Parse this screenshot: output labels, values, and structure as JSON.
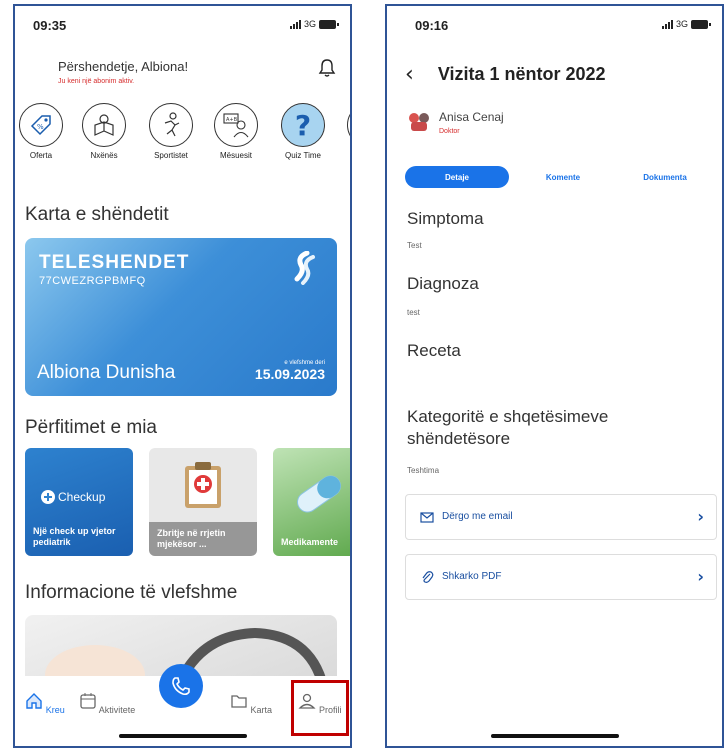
{
  "left_screen": {
    "status": {
      "time": "09:35",
      "network": "3G"
    },
    "greeting": "Përshendetje, Albiona!",
    "subscription_note": "Ju keni një abonim aktiv.",
    "categories": [
      {
        "label": "Oferta",
        "icon": "discount-tag-icon"
      },
      {
        "label": "Nxënës",
        "icon": "student-reading-icon"
      },
      {
        "label": "Sportistet",
        "icon": "athlete-icon"
      },
      {
        "label": "Mësuesit",
        "icon": "teacher-icon"
      },
      {
        "label": "Quiz Time",
        "icon": "question-mark-icon"
      }
    ],
    "health_card_title": "Karta e shëndetit",
    "card": {
      "brand": "TELESHENDET",
      "code": "77CWEZRGPBMFQ",
      "holder": "Albiona Dunisha",
      "valid_label": "e vlefshme deri",
      "valid_date": "15.09.2023"
    },
    "benefits_title": "Përfitimet e mia",
    "benefits": [
      {
        "title": "Një check up vjetor pediatrik",
        "badge": "Checkup"
      },
      {
        "title": "Zbritje në rrjetin mjekësor ..."
      },
      {
        "title": "Medikamente"
      }
    ],
    "info_title": "Informacione të vlefshme",
    "tabs": [
      {
        "label": "Kreu",
        "icon": "home-icon",
        "active": true
      },
      {
        "label": "Aktivitete",
        "icon": "calendar-icon"
      },
      {
        "label": "Karta",
        "icon": "folder-icon"
      },
      {
        "label": "Profili",
        "icon": "user-icon"
      }
    ],
    "accent": "#1a73e8",
    "highlight_color": "#c00000"
  },
  "right_screen": {
    "status": {
      "time": "09:16",
      "network": "3G"
    },
    "title": "Vizita 1 nëntor 2022",
    "doctor": {
      "name": "Anisa Cenaj",
      "role": "Doktor"
    },
    "segments": [
      "Detaje",
      "Komente",
      "Dokumenta"
    ],
    "sections": {
      "symptoms_label": "Simptoma",
      "symptoms_value": "Test",
      "diagnosis_label": "Diagnoza",
      "diagnosis_value": "test",
      "prescription_label": "Receta",
      "categories_label": "Kategoritë e shqetësimeve shëndetësore",
      "categories_value": "Teshtima"
    },
    "actions": [
      {
        "label": "Dërgo me email",
        "icon": "mail-icon"
      },
      {
        "label": "Shkarko PDF",
        "icon": "paperclip-icon"
      }
    ]
  }
}
